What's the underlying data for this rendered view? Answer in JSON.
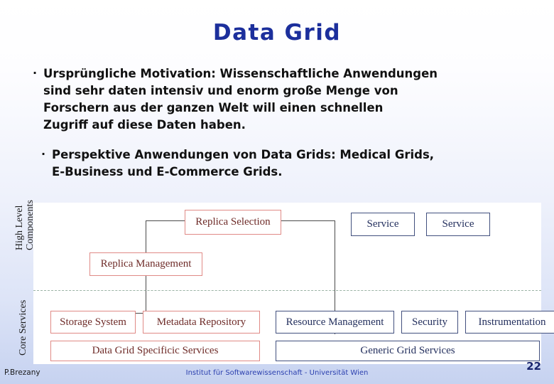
{
  "slide": {
    "title": "Data Grid",
    "title_color": "#1c2f9c",
    "background_top_color": "#ffffff",
    "background_bottom_color": "#c6d2f0"
  },
  "bullets": [
    {
      "marker": "·",
      "lines": [
        "Ursprüngliche Motivation: Wissenschaftliche Anwendungen",
        "sind sehr daten intensiv und enorm große Menge von",
        "Forschern aus der ganzen Welt will einen schnellen",
        "Zugriff auf diese Daten haben."
      ]
    },
    {
      "marker": "·",
      "lines": [
        "Perspektive Anwendungen von Data Grids: Medical Grids,",
        "E-Business und E-Commerce Grids."
      ]
    }
  ],
  "diagram": {
    "side_labels": {
      "high_level_line1": "High Level",
      "high_level_line2": "Components",
      "core_services": "Core Services"
    },
    "red_color": "#e08a86",
    "red_text_color": "#6e2b28",
    "navy_color": "#42507e",
    "navy_text_color": "#24305e",
    "divider_color": "#9bb3a5",
    "boxes": {
      "replica_selection": "Replica Selection",
      "replica_management": "Replica Management",
      "service_1": "Service",
      "service_2": "Service",
      "storage_system": "Storage System",
      "metadata_repository": "Metadata Repository",
      "data_grid_specific_services": "Data Grid Specificic Services",
      "resource_management": "Resource Management",
      "security": "Security",
      "instrumentation": "Instrumentation",
      "generic_grid_services": "Generic Grid Services"
    }
  },
  "footer": {
    "author": "P.Brezany",
    "institute": "Institut für Softwarewissenschaft - Universität Wien",
    "page_number": "22"
  }
}
